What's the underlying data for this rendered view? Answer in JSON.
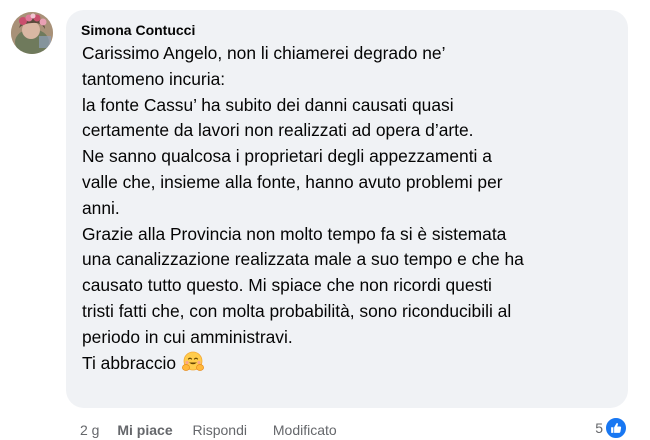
{
  "comment": {
    "author": "Simona Contucci",
    "lines": [
      "Carissimo Angelo, non li chiamerei degrado ne’",
      "tantomeno incuria:",
      "la fonte Cassu’ ha subito dei danni causati quasi",
      "certamente da lavori non realizzati ad opera d’arte.",
      "Ne sanno qualcosa i proprietari degli appezzamenti a",
      "valle che, insieme alla fonte, hanno avuto problemi per",
      "anni.",
      "Grazie alla Provincia non molto tempo fa si è sistemata",
      "una canalizzazione realizzata male a suo tempo e che ha",
      "causato tutto questo. Mi spiace che non ricordi questi",
      "tristi fatti che, con molta probabilità, sono riconducibili al",
      "periodo in cui amministravi."
    ],
    "last_line": "Ti abbraccio",
    "emoji": "hugging-face-emoji"
  },
  "actions": {
    "time": "2 g",
    "like_label": "Mi piace",
    "reply_label": "Rispondi",
    "edited_label": "Modificato"
  },
  "reactions": {
    "count": "5",
    "icon": "thumbs-up-icon",
    "color": "#1877f2"
  },
  "colors": {
    "bubble": "#f0f2f5",
    "secondary_text": "#65676b",
    "primary_text": "#050505"
  }
}
